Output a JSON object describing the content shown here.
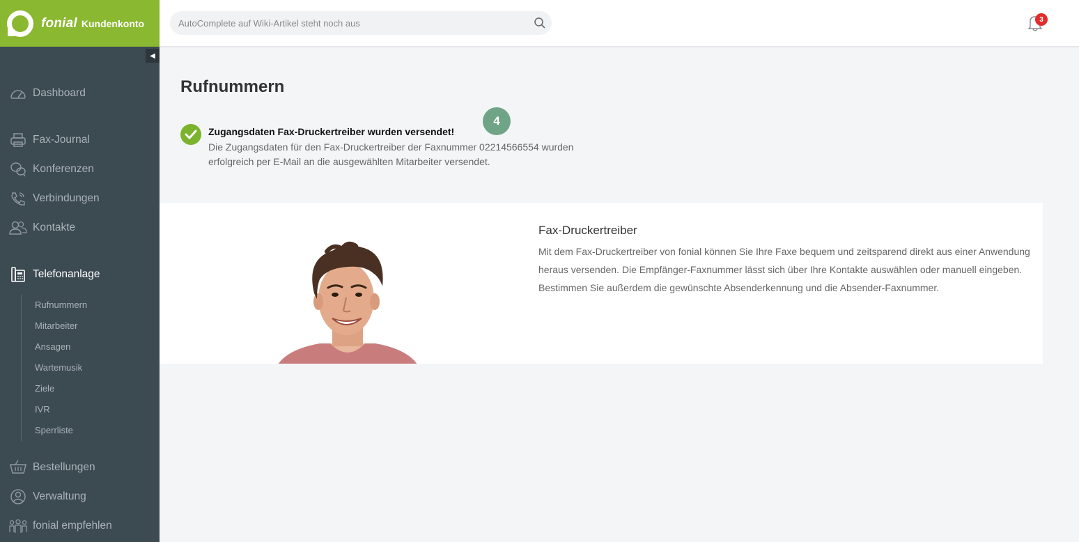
{
  "brand": {
    "name": "fonial",
    "subtitle": "Kundenkonto"
  },
  "search": {
    "placeholder": "AutoComplete auf Wiki-Artikel steht noch aus"
  },
  "notifications": {
    "count": "3"
  },
  "nav": {
    "dashboard": "Dashboard",
    "fax_journal": "Fax-Journal",
    "konferenzen": "Konferenzen",
    "verbindungen": "Verbindungen",
    "kontakte": "Kontakte",
    "telefonanlage": "Telefonanlage",
    "sub": [
      "Rufnummern",
      "Mitarbeiter",
      "Ansagen",
      "Wartemusik",
      "Ziele",
      "IVR",
      "Sperrliste"
    ],
    "bestellungen": "Bestellungen",
    "verwaltung": "Verwaltung",
    "empfehlen": "fonial empfehlen"
  },
  "page": {
    "title": "Rufnummern"
  },
  "alert": {
    "title": "Zugangsdaten Fax-Druckertreiber wurden versendet!",
    "text": "Die Zugangsdaten für den Fax-Druckertreiber der Faxnummer 02214566554 wurden erfolgreich per E-Mail an die ausgewählten Mitarbeiter versendet."
  },
  "step_badge": "4",
  "card": {
    "title": "Fax-Druckertreiber",
    "text": "Mit dem Fax-Druckertreiber von fonial können Sie Ihre Faxe bequem und zeitsparend direkt aus einer Anwendung heraus versenden. Die Empfänger-Faxnummer lässt sich über Ihre Kontakte auswählen oder manuell eingeben. Bestimmen Sie außerdem die gewünschte Absenderkennung und die Absender-Faxnummer."
  },
  "colors": {
    "brand_green": "#8ab830",
    "sidebar": "#3c4a52",
    "success": "#7cb32c",
    "badge": "#6fa586",
    "alert_red": "#e32b2b"
  }
}
